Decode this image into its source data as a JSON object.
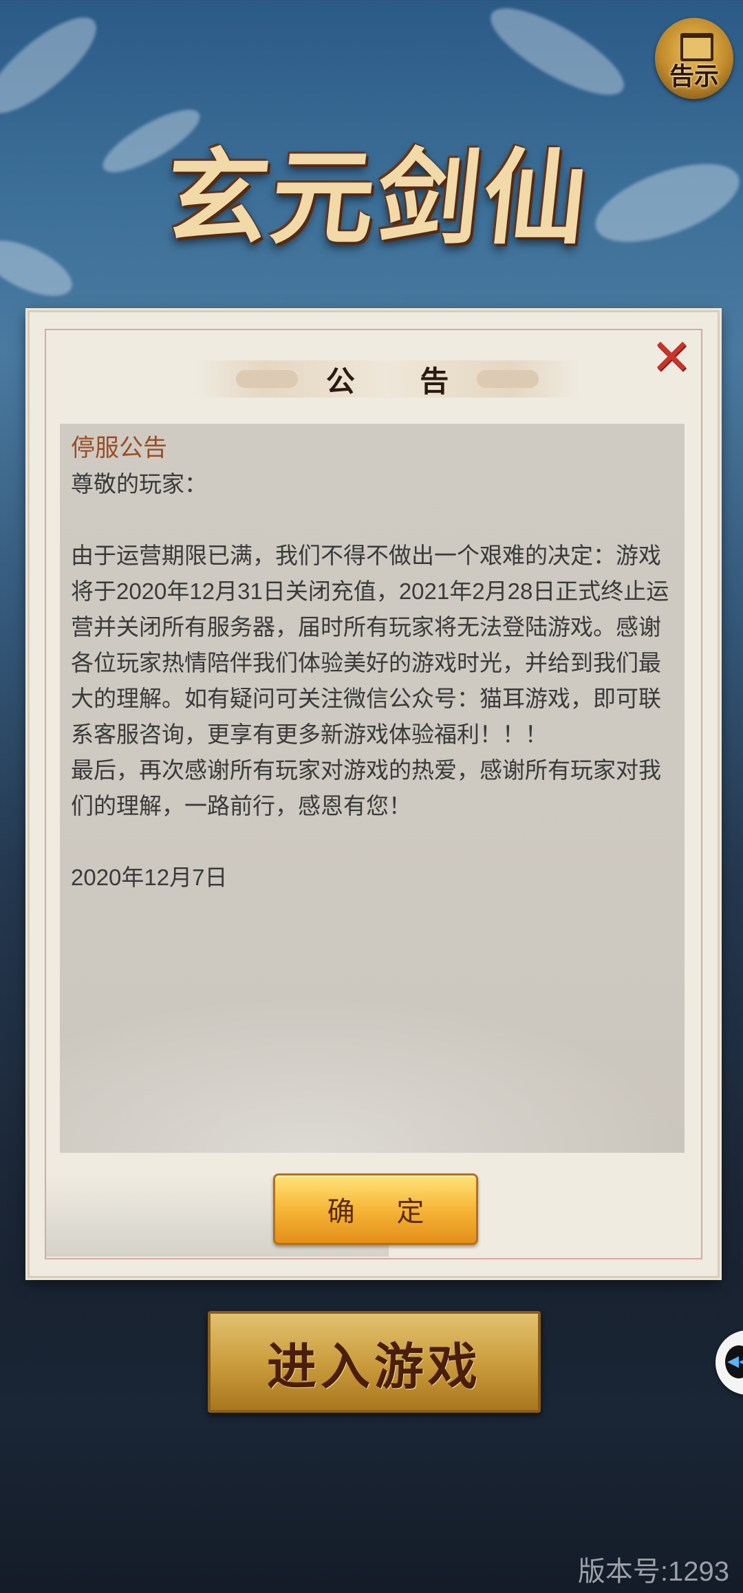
{
  "game": {
    "logo_text": "玄元剑仙"
  },
  "notice_button": {
    "label": "告示",
    "icon": "scroll-notice-icon"
  },
  "dialog": {
    "title": "公 告",
    "close_icon": "close-x-icon",
    "heading": "停服公告",
    "body": "尊敬的玩家：\n\n由于运营期限已满，我们不得不做出一个艰难的决定：游戏将于2020年12月31日关闭充值，2021年2月28日正式终止运营并关闭所有服务器，届时所有玩家将无法登陆游戏。感谢各位玩家热情陪伴我们体验美好的游戏时光，并给到我们最大的理解。如有疑问可关注微信公众号：猫耳游戏，即可联系客服咨询，更享有更多新游戏体验福利！！！\n最后，再次感谢所有玩家对游戏的热爱，感谢所有玩家对我们的理解，一路前行，感恩有您！\n\n2020年12月7日",
    "confirm_label": "确 定"
  },
  "enter_game": {
    "label": "进入游戏"
  },
  "side_tab": {
    "icon": "rewind-icon"
  },
  "version": {
    "label": "版本号:1293"
  },
  "colors": {
    "close": "#c8332a",
    "heading": "#9a4d24",
    "confirm_gold": "#f6b637",
    "enter_gold": "#c99a3a"
  }
}
